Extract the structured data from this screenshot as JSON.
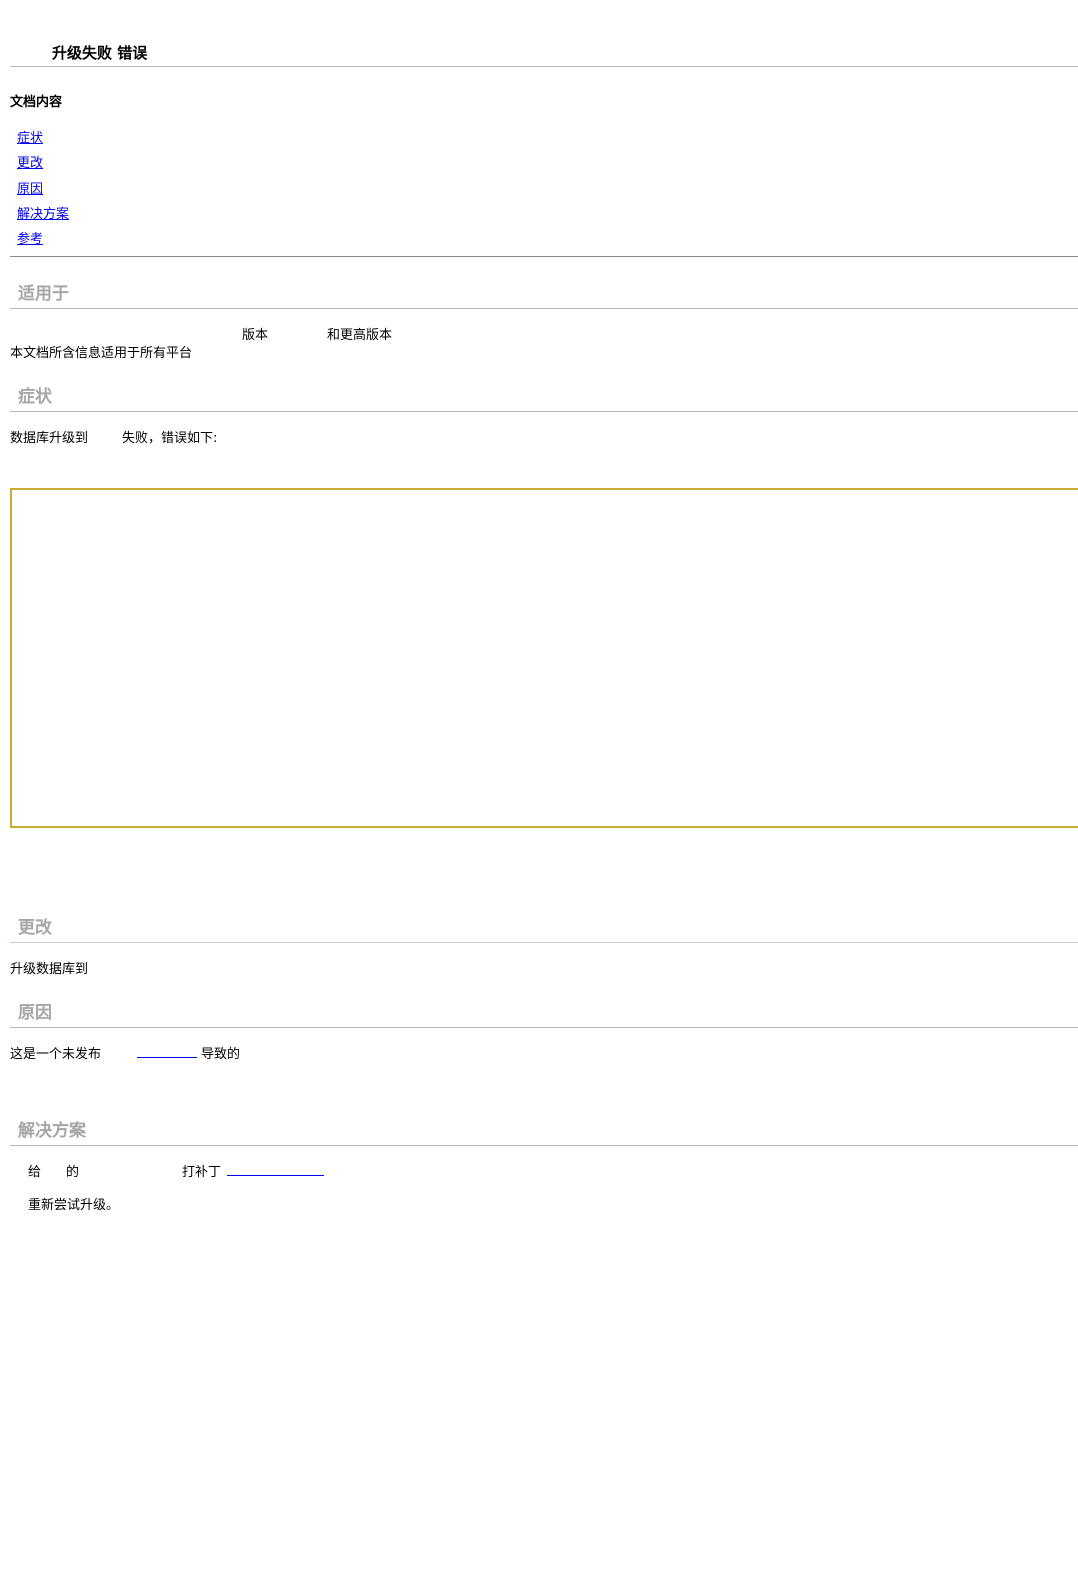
{
  "doc": {
    "title": "升级失败 错误"
  },
  "toc": {
    "heading": "文档内容",
    "items": [
      "症状",
      "更改",
      "原因",
      "解决方案",
      "参考"
    ]
  },
  "applies_to": {
    "heading": "适用于",
    "version_label": "版本",
    "higher_label": "和更高版本",
    "platform_text": "本文档所含信息适用于所有平台"
  },
  "symptoms": {
    "heading": "症状",
    "text_a": "数据库升级到",
    "text_b": "失败，错误如下:"
  },
  "changes": {
    "heading": "更改",
    "text": "升级数据库到"
  },
  "cause": {
    "heading": "原因",
    "text_a": "这是一个未发布",
    "text_b": "导致的"
  },
  "solution": {
    "heading": "解决方案",
    "give": "给",
    "of": "的",
    "apply_patch": "打补丁",
    "retry": "重新尝试升级。"
  }
}
